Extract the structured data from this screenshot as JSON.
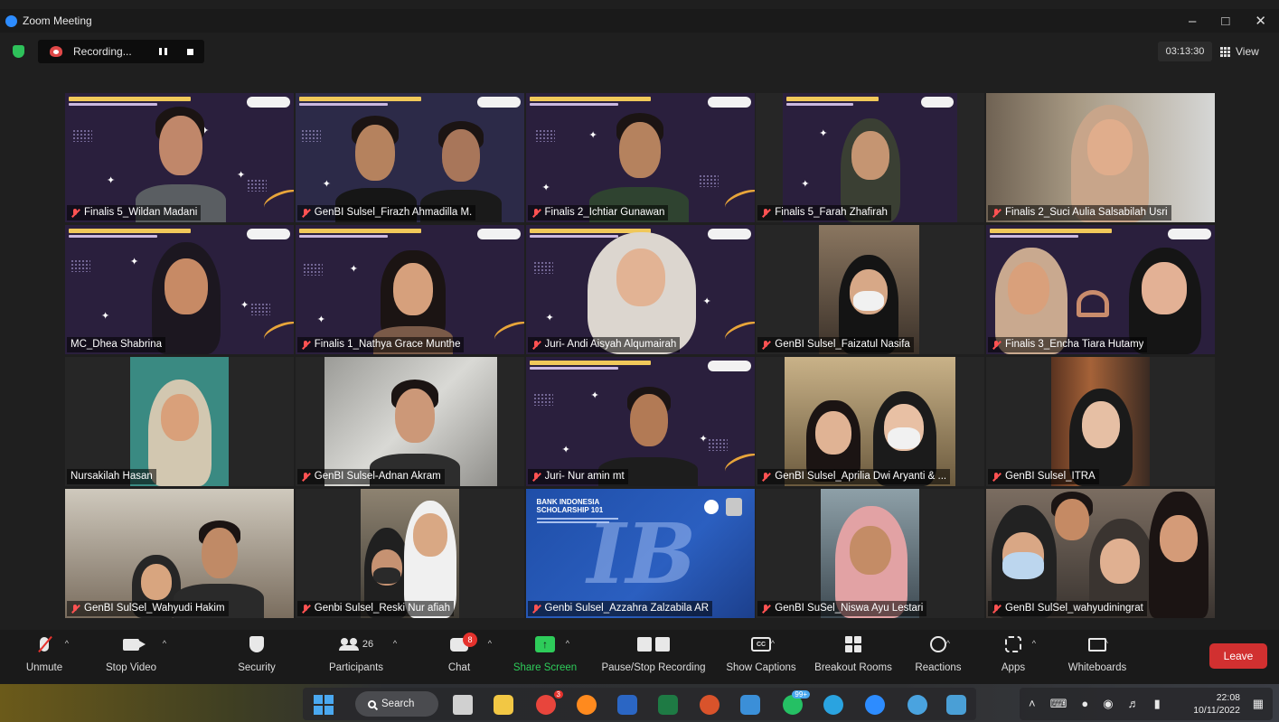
{
  "window": {
    "title": "Zoom Meeting"
  },
  "recording": {
    "label": "Recording..."
  },
  "timer": "03:13:30",
  "view_label": "View",
  "participants": [
    {
      "name": "Finalis 5_Wildan Madani",
      "muted": true,
      "speaking": false
    },
    {
      "name": "GenBI Sulsel_Firazh Ahmadilla M.",
      "muted": true,
      "speaking": false
    },
    {
      "name": "Finalis 2_Ichtiar Gunawan",
      "muted": true,
      "speaking": false
    },
    {
      "name": "Finalis 5_Farah Zhafirah",
      "muted": true,
      "speaking": false
    },
    {
      "name": "Finalis 2_Suci Aulia Salsabilah Usri",
      "muted": true,
      "speaking": false
    },
    {
      "name": "MC_Dhea Shabrina",
      "muted": false,
      "speaking": true
    },
    {
      "name": "Finalis 1_Nathya Grace Munthe",
      "muted": true,
      "speaking": false
    },
    {
      "name": "Juri- Andi Aisyah Alqumairah",
      "muted": true,
      "speaking": false
    },
    {
      "name": "GenBI Sulsel_Faizatul Nasifa",
      "muted": true,
      "speaking": false
    },
    {
      "name": "Finalis 3_Encha Tiara Hutamy",
      "muted": true,
      "speaking": false
    },
    {
      "name": "Nursakilah Hasan",
      "muted": false,
      "speaking": false
    },
    {
      "name": "GenBI Sulsel-Adnan Akram",
      "muted": true,
      "speaking": false
    },
    {
      "name": "Juri- Nur amin mt",
      "muted": true,
      "speaking": false
    },
    {
      "name": "GenBI Sulsel_Aprilia Dwi Aryanti & ...",
      "muted": true,
      "speaking": false
    },
    {
      "name": "GenBI Sulsel_ITRA",
      "muted": true,
      "speaking": false
    },
    {
      "name": "GenBI SulSel_Wahyudi Hakim",
      "muted": true,
      "speaking": false
    },
    {
      "name": "Genbi Sulsel_Reski Nur afiah",
      "muted": true,
      "speaking": false
    },
    {
      "name": "Genbi Sulsel_Azzahra Zalzabila AR",
      "muted": true,
      "speaking": false
    },
    {
      "name": "GenBI SuSel_Niswa Ayu Lestari",
      "muted": true,
      "speaking": false
    },
    {
      "name": "GenBI SulSel_wahyudiningrat",
      "muted": true,
      "speaking": false
    }
  ],
  "shared_screen": {
    "line1": "BANK INDONESIA",
    "line2": "SCHOLARSHIP 101"
  },
  "toolbar": {
    "unmute": "Unmute",
    "stop_video": "Stop Video",
    "security": "Security",
    "participants": "Participants",
    "participants_count": "26",
    "chat": "Chat",
    "chat_badge": "8",
    "share_screen": "Share Screen",
    "pause_stop_recording": "Pause/Stop Recording",
    "show_captions": "Show Captions",
    "cc": "CC",
    "breakout_rooms": "Breakout Rooms",
    "reactions": "Reactions",
    "apps": "Apps",
    "whiteboards": "Whiteboards",
    "leave": "Leave"
  },
  "taskbar": {
    "search_label": "Search",
    "whatsapp_badge": "99+",
    "chrome_badge": "3",
    "time": "22:08",
    "date": "10/11/2022"
  },
  "colors": {
    "speaking_outline": "#e8e35a",
    "share_green": "#2ecc5a",
    "leave_red": "#d13030",
    "banner_purple": "#2a1f3d"
  }
}
